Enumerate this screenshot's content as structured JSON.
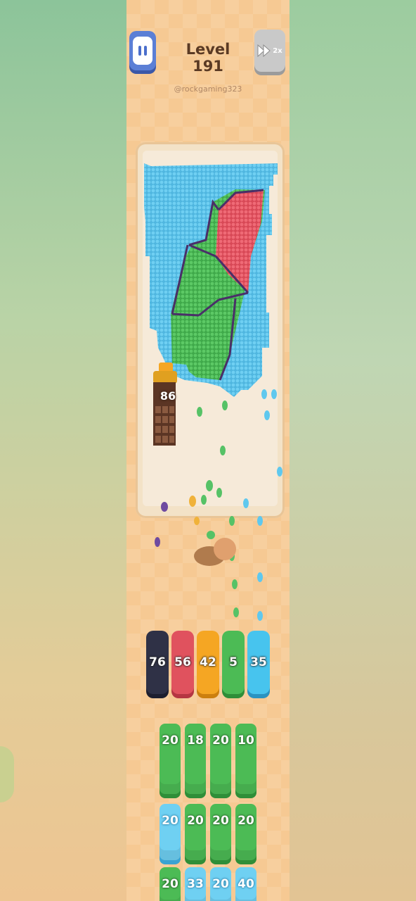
{
  "header": {
    "level_title": "Level 191",
    "username": "@rockgaming323",
    "speed_label": "2x"
  },
  "board": {
    "counter_value": "86"
  },
  "queue": [
    {
      "value": "76",
      "color": "#2f3146",
      "shade": "#1e1f2f"
    },
    {
      "value": "56",
      "color": "#e0525e",
      "shade": "#b53642"
    },
    {
      "value": "42",
      "color": "#f5a623",
      "shade": "#cc7f0e"
    },
    {
      "value": "5",
      "color": "#4cbb55",
      "shade": "#2f8e38"
    },
    {
      "value": "35",
      "color": "#47c4ee",
      "shade": "#2a93c1"
    }
  ],
  "grid": [
    [
      {
        "value": "20",
        "color": "green"
      },
      {
        "value": "18",
        "color": "green"
      },
      {
        "value": "20",
        "color": "green"
      },
      {
        "value": "10",
        "color": "green"
      }
    ],
    [
      {
        "value": "20",
        "color": "blue"
      },
      {
        "value": "20",
        "color": "green"
      },
      {
        "value": "20",
        "color": "green"
      },
      {
        "value": "20",
        "color": "green"
      }
    ],
    [
      {
        "value": "20",
        "color": "green"
      },
      {
        "value": "33",
        "color": "blue"
      },
      {
        "value": "20",
        "color": "blue"
      },
      {
        "value": "40",
        "color": "blue"
      }
    ]
  ],
  "colors": {
    "sky": "#5bc3e8",
    "grass": "#4cbb55",
    "roof": "#e0525e",
    "outline": "#4a2f68",
    "chocolate": "#5b3524"
  }
}
